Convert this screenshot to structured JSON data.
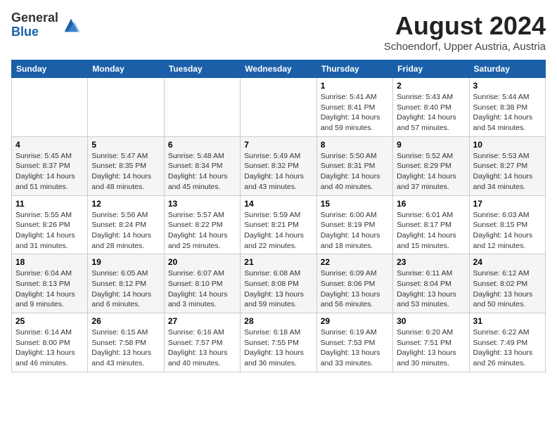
{
  "header": {
    "logo_general": "General",
    "logo_blue": "Blue",
    "title": "August 2024",
    "location": "Schoendorf, Upper Austria, Austria"
  },
  "weekdays": [
    "Sunday",
    "Monday",
    "Tuesday",
    "Wednesday",
    "Thursday",
    "Friday",
    "Saturday"
  ],
  "weeks": [
    [
      {
        "day": "",
        "info": ""
      },
      {
        "day": "",
        "info": ""
      },
      {
        "day": "",
        "info": ""
      },
      {
        "day": "",
        "info": ""
      },
      {
        "day": "1",
        "info": "Sunrise: 5:41 AM\nSunset: 8:41 PM\nDaylight: 14 hours\nand 59 minutes."
      },
      {
        "day": "2",
        "info": "Sunrise: 5:43 AM\nSunset: 8:40 PM\nDaylight: 14 hours\nand 57 minutes."
      },
      {
        "day": "3",
        "info": "Sunrise: 5:44 AM\nSunset: 8:38 PM\nDaylight: 14 hours\nand 54 minutes."
      }
    ],
    [
      {
        "day": "4",
        "info": "Sunrise: 5:45 AM\nSunset: 8:37 PM\nDaylight: 14 hours\nand 51 minutes."
      },
      {
        "day": "5",
        "info": "Sunrise: 5:47 AM\nSunset: 8:35 PM\nDaylight: 14 hours\nand 48 minutes."
      },
      {
        "day": "6",
        "info": "Sunrise: 5:48 AM\nSunset: 8:34 PM\nDaylight: 14 hours\nand 45 minutes."
      },
      {
        "day": "7",
        "info": "Sunrise: 5:49 AM\nSunset: 8:32 PM\nDaylight: 14 hours\nand 43 minutes."
      },
      {
        "day": "8",
        "info": "Sunrise: 5:50 AM\nSunset: 8:31 PM\nDaylight: 14 hours\nand 40 minutes."
      },
      {
        "day": "9",
        "info": "Sunrise: 5:52 AM\nSunset: 8:29 PM\nDaylight: 14 hours\nand 37 minutes."
      },
      {
        "day": "10",
        "info": "Sunrise: 5:53 AM\nSunset: 8:27 PM\nDaylight: 14 hours\nand 34 minutes."
      }
    ],
    [
      {
        "day": "11",
        "info": "Sunrise: 5:55 AM\nSunset: 8:26 PM\nDaylight: 14 hours\nand 31 minutes."
      },
      {
        "day": "12",
        "info": "Sunrise: 5:56 AM\nSunset: 8:24 PM\nDaylight: 14 hours\nand 28 minutes."
      },
      {
        "day": "13",
        "info": "Sunrise: 5:57 AM\nSunset: 8:22 PM\nDaylight: 14 hours\nand 25 minutes."
      },
      {
        "day": "14",
        "info": "Sunrise: 5:59 AM\nSunset: 8:21 PM\nDaylight: 14 hours\nand 22 minutes."
      },
      {
        "day": "15",
        "info": "Sunrise: 6:00 AM\nSunset: 8:19 PM\nDaylight: 14 hours\nand 18 minutes."
      },
      {
        "day": "16",
        "info": "Sunrise: 6:01 AM\nSunset: 8:17 PM\nDaylight: 14 hours\nand 15 minutes."
      },
      {
        "day": "17",
        "info": "Sunrise: 6:03 AM\nSunset: 8:15 PM\nDaylight: 14 hours\nand 12 minutes."
      }
    ],
    [
      {
        "day": "18",
        "info": "Sunrise: 6:04 AM\nSunset: 8:13 PM\nDaylight: 14 hours\nand 9 minutes."
      },
      {
        "day": "19",
        "info": "Sunrise: 6:05 AM\nSunset: 8:12 PM\nDaylight: 14 hours\nand 6 minutes."
      },
      {
        "day": "20",
        "info": "Sunrise: 6:07 AM\nSunset: 8:10 PM\nDaylight: 14 hours\nand 3 minutes."
      },
      {
        "day": "21",
        "info": "Sunrise: 6:08 AM\nSunset: 8:08 PM\nDaylight: 13 hours\nand 59 minutes."
      },
      {
        "day": "22",
        "info": "Sunrise: 6:09 AM\nSunset: 8:06 PM\nDaylight: 13 hours\nand 56 minutes."
      },
      {
        "day": "23",
        "info": "Sunrise: 6:11 AM\nSunset: 8:04 PM\nDaylight: 13 hours\nand 53 minutes."
      },
      {
        "day": "24",
        "info": "Sunrise: 6:12 AM\nSunset: 8:02 PM\nDaylight: 13 hours\nand 50 minutes."
      }
    ],
    [
      {
        "day": "25",
        "info": "Sunrise: 6:14 AM\nSunset: 8:00 PM\nDaylight: 13 hours\nand 46 minutes."
      },
      {
        "day": "26",
        "info": "Sunrise: 6:15 AM\nSunset: 7:58 PM\nDaylight: 13 hours\nand 43 minutes."
      },
      {
        "day": "27",
        "info": "Sunrise: 6:16 AM\nSunset: 7:57 PM\nDaylight: 13 hours\nand 40 minutes."
      },
      {
        "day": "28",
        "info": "Sunrise: 6:18 AM\nSunset: 7:55 PM\nDaylight: 13 hours\nand 36 minutes."
      },
      {
        "day": "29",
        "info": "Sunrise: 6:19 AM\nSunset: 7:53 PM\nDaylight: 13 hours\nand 33 minutes."
      },
      {
        "day": "30",
        "info": "Sunrise: 6:20 AM\nSunset: 7:51 PM\nDaylight: 13 hours\nand 30 minutes."
      },
      {
        "day": "31",
        "info": "Sunrise: 6:22 AM\nSunset: 7:49 PM\nDaylight: 13 hours\nand 26 minutes."
      }
    ]
  ]
}
